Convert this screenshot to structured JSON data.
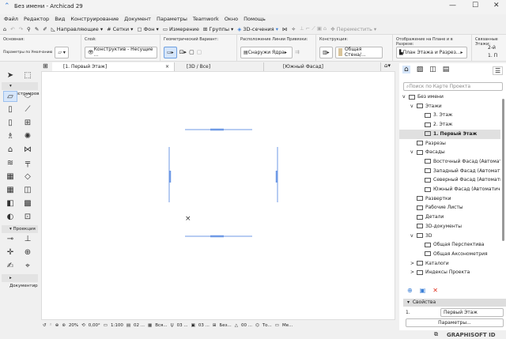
{
  "window": {
    "title": "Без имени - Archicad 29",
    "min": "—",
    "max": "☐",
    "close": "✕"
  },
  "menu": [
    "Файл",
    "Редактор",
    "Вид",
    "Конструирование",
    "Документ",
    "Параметры",
    "Teamwork",
    "Окно",
    "Помощь"
  ],
  "toolbar": {
    "guides": "Направляющие",
    "grids": "Сетки",
    "background": "Фон",
    "measure": "Измерение",
    "groups": "Группы",
    "sections3d": "3D-сечения",
    "move": "Переместить"
  },
  "infobox": {
    "main_label": "Основная:",
    "main_value": "Параметры по Умолчанию",
    "layer_label": "Слой:",
    "layer_value": "Конструктив - Несущие ...",
    "geom_label": "Геометрический Вариант:",
    "refline_label": "Расположение Линии Привязки:",
    "refline_value": "Снаружи Ядра",
    "structure_label": "Конструкция:",
    "structure_value": "Общая Стена/...",
    "display_label": "Отображение на Плане и в Разрезе:",
    "display_value": "План Этажа и Разрез...",
    "linked_label": "Связанные Этажи:",
    "linked_top": "2-й",
    "linked_bottom": "1. П"
  },
  "tabs": [
    {
      "label": "[1. Первый Этаж]"
    },
    {
      "label": "[3D / Все]"
    },
    {
      "label": "[Южный Фасад]"
    }
  ],
  "toolbox": {
    "sections": [
      "Конструиров",
      "Проекция",
      "Документир"
    ]
  },
  "status": {
    "zoom": "20%",
    "angle": "0,00°",
    "scale": "1:100",
    "s1": "02 ...",
    "s2": "Вся...",
    "s3": "03 ...",
    "s4": "03 ...",
    "s5": "Без...",
    "s6": "00 ...",
    "s7": "То...",
    "s8": "Ме..."
  },
  "navigator": {
    "search_placeholder": "Поиск по Карте Проекта",
    "tree": [
      {
        "label": "Без имени",
        "level": 0,
        "exp": "v"
      },
      {
        "label": "Этажи",
        "level": 1,
        "exp": "v"
      },
      {
        "label": "3. Этаж",
        "level": 2
      },
      {
        "label": "2. Этаж",
        "level": 2
      },
      {
        "label": "1. Первый Этаж",
        "level": 2,
        "selected": true
      },
      {
        "label": "Разрезы",
        "level": 1
      },
      {
        "label": "Фасады",
        "level": 1,
        "exp": "v"
      },
      {
        "label": "Восточный Фасад (Автоматич",
        "level": 2
      },
      {
        "label": "Западный Фасад (Автоматиче",
        "level": 2
      },
      {
        "label": "Северный Фасад (Автоматиче",
        "level": 2
      },
      {
        "label": "Южный Фасад (Автоматическ",
        "level": 2
      },
      {
        "label": "Развертки",
        "level": 1
      },
      {
        "label": "Рабочие Листы",
        "level": 1
      },
      {
        "label": "Детали",
        "level": 1
      },
      {
        "label": "3D-документы",
        "level": 1
      },
      {
        "label": "3D",
        "level": 1,
        "exp": "v"
      },
      {
        "label": "Общая Перспектива",
        "level": 2
      },
      {
        "label": "Общая Аксонометрия",
        "level": 2
      },
      {
        "label": "Каталоги",
        "level": 1,
        "exp": ">"
      },
      {
        "label": "Индексы Проекта",
        "level": 1,
        "exp": ">"
      }
    ],
    "properties": "Свойства",
    "prop_id": "1.",
    "prop_name": "Первый Этаж",
    "params_button": "Параметры..."
  },
  "brand": "GRAPHISOFT ID",
  "colors": {
    "accent": "#3b7fd6",
    "selected": "#e0e0e0",
    "wall": "#6f9ae6",
    "delete": "#e0301e"
  }
}
